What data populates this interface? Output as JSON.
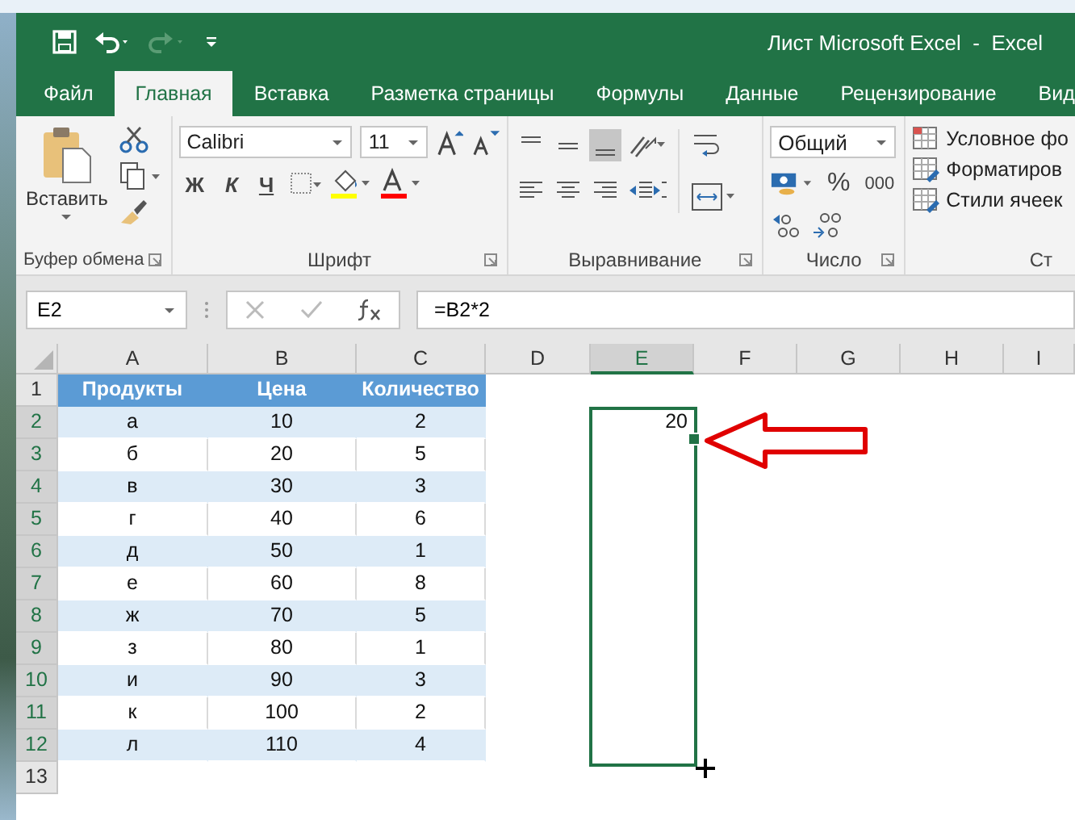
{
  "window": {
    "title": "Лист Microsoft Excel  -  Excel"
  },
  "tabs": [
    {
      "label": "Файл",
      "selected": false
    },
    {
      "label": "Главная",
      "selected": true
    },
    {
      "label": "Вставка",
      "selected": false
    },
    {
      "label": "Разметка страницы",
      "selected": false
    },
    {
      "label": "Формулы",
      "selected": false
    },
    {
      "label": "Данные",
      "selected": false
    },
    {
      "label": "Рецензирование",
      "selected": false
    },
    {
      "label": "Вид",
      "selected": false
    }
  ],
  "ribbon": {
    "clipboard": {
      "paste": "Вставить",
      "label": "Буфер обмена"
    },
    "font": {
      "name": "Calibri",
      "size": "11",
      "bold": "Ж",
      "italic": "К",
      "underline": "Ч",
      "label": "Шрифт"
    },
    "alignment": {
      "label": "Выравнивание"
    },
    "number": {
      "format": "Общий",
      "percent": "%",
      "thousands": "000",
      "label": "Число"
    },
    "styles": {
      "items": [
        "Условное фо",
        "Форматиров",
        "Стили ячеек"
      ],
      "label": "Ст"
    }
  },
  "formula_bar": {
    "name_box": "E2",
    "formula": "=B2*2"
  },
  "grid": {
    "columns": [
      {
        "label": "A",
        "selected": false
      },
      {
        "label": "B",
        "selected": false
      },
      {
        "label": "C",
        "selected": false
      },
      {
        "label": "D",
        "selected": false
      },
      {
        "label": "E",
        "selected": true
      },
      {
        "label": "F",
        "selected": false
      },
      {
        "label": "G",
        "selected": false
      },
      {
        "label": "H",
        "selected": false
      },
      {
        "label": "I",
        "selected": false
      }
    ],
    "rows": [
      {
        "number": "1",
        "kind": "header",
        "selected": false,
        "cells": [
          "Продукты",
          "Цена",
          "Количество"
        ],
        "e": null
      },
      {
        "number": "2",
        "kind": "data",
        "selected": true,
        "cells": [
          "а",
          "10",
          "2"
        ],
        "e": "20"
      },
      {
        "number": "3",
        "kind": "data",
        "selected": true,
        "cells": [
          "б",
          "20",
          "5"
        ],
        "e": null
      },
      {
        "number": "4",
        "kind": "data",
        "selected": true,
        "cells": [
          "в",
          "30",
          "3"
        ],
        "e": null
      },
      {
        "number": "5",
        "kind": "data",
        "selected": true,
        "cells": [
          "г",
          "40",
          "6"
        ],
        "e": null
      },
      {
        "number": "6",
        "kind": "data",
        "selected": true,
        "cells": [
          "д",
          "50",
          "1"
        ],
        "e": null
      },
      {
        "number": "7",
        "kind": "data",
        "selected": true,
        "cells": [
          "е",
          "60",
          "8"
        ],
        "e": null
      },
      {
        "number": "8",
        "kind": "data",
        "selected": true,
        "cells": [
          "ж",
          "70",
          "5"
        ],
        "e": null
      },
      {
        "number": "9",
        "kind": "data",
        "selected": true,
        "cells": [
          "з",
          "80",
          "1"
        ],
        "e": null
      },
      {
        "number": "10",
        "kind": "data",
        "selected": true,
        "cells": [
          "и",
          "90",
          "3"
        ],
        "e": null
      },
      {
        "number": "11",
        "kind": "data",
        "selected": true,
        "cells": [
          "к",
          "100",
          "2"
        ],
        "e": null
      },
      {
        "number": "12",
        "kind": "data",
        "selected": true,
        "cells": [
          "л",
          "110",
          "4"
        ],
        "e": null
      },
      {
        "number": "13",
        "kind": "empty",
        "selected": false,
        "cells": [],
        "e": null
      }
    ]
  }
}
